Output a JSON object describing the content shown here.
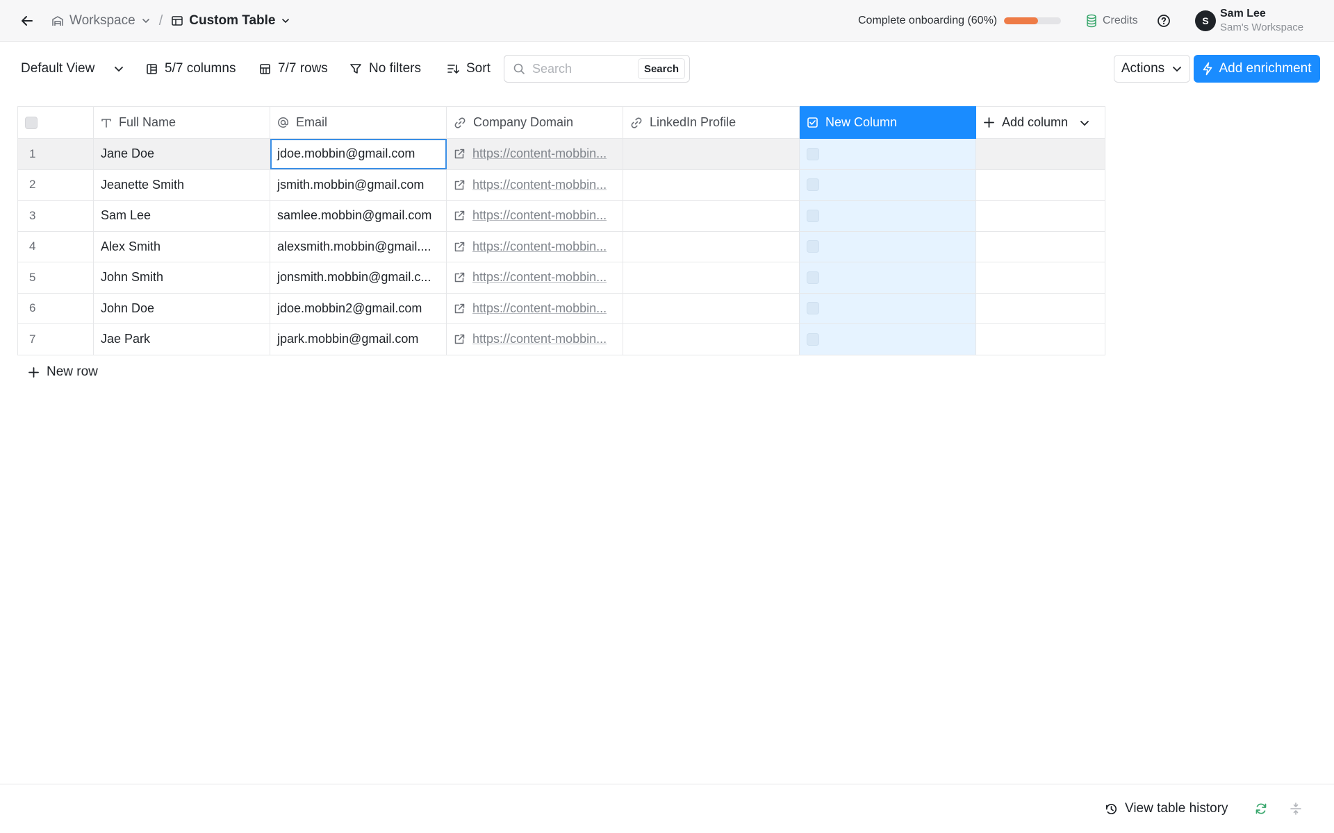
{
  "header": {
    "breadcrumbs": [
      {
        "label": "Workspace",
        "icon": "warehouse-icon"
      },
      {
        "label": "Custom Table",
        "icon": "table-icon"
      }
    ],
    "separator": "/",
    "onboarding": {
      "label": "Complete onboarding (60%)",
      "progress": 0.6
    },
    "credits_label": "Credits",
    "user": {
      "initial": "S",
      "name": "Sam Lee",
      "workspace": "Sam's Workspace"
    }
  },
  "toolbar": {
    "view_label": "Default View",
    "columns_label": "5/7 columns",
    "rows_label": "7/7 rows",
    "filters_label": "No filters",
    "sort_label": "Sort",
    "search": {
      "placeholder": "Search",
      "button": "Search"
    },
    "actions_label": "Actions",
    "enrich_label": "Add enrichment"
  },
  "table": {
    "columns": [
      {
        "label": "Full Name",
        "icon": "text-type-icon"
      },
      {
        "label": "Email",
        "icon": "at-icon"
      },
      {
        "label": "Company Domain",
        "icon": "link-icon"
      },
      {
        "label": "LinkedIn Profile",
        "icon": "link-icon"
      },
      {
        "label": "New Column",
        "icon": "checkbox-icon"
      }
    ],
    "add_column_label": "Add column",
    "rows": [
      {
        "index": "1",
        "name": "Jane Doe",
        "email": "jdoe.mobbin@gmail.com",
        "domain": "https://content-mobbin..."
      },
      {
        "index": "2",
        "name": "Jeanette Smith",
        "email": "jsmith.mobbin@gmail.com",
        "domain": "https://content-mobbin..."
      },
      {
        "index": "3",
        "name": "Sam Lee",
        "email": "samlee.mobbin@gmail.com",
        "domain": "https://content-mobbin..."
      },
      {
        "index": "4",
        "name": "Alex Smith",
        "email": "alexsmith.mobbin@gmail....",
        "domain": "https://content-mobbin..."
      },
      {
        "index": "5",
        "name": "John Smith",
        "email": "jonsmith.mobbin@gmail.c...",
        "domain": "https://content-mobbin..."
      },
      {
        "index": "6",
        "name": "John Doe",
        "email": "jdoe.mobbin2@gmail.com",
        "domain": "https://content-mobbin..."
      },
      {
        "index": "7",
        "name": "Jae Park",
        "email": "jpark.mobbin@gmail.com",
        "domain": "https://content-mobbin..."
      }
    ],
    "new_row_label": "New row"
  },
  "footer": {
    "history_label": "View table history"
  },
  "colors": {
    "accent": "#1a8cff",
    "progress": "#ee7b46",
    "credits_icon": "#3aa76d"
  }
}
